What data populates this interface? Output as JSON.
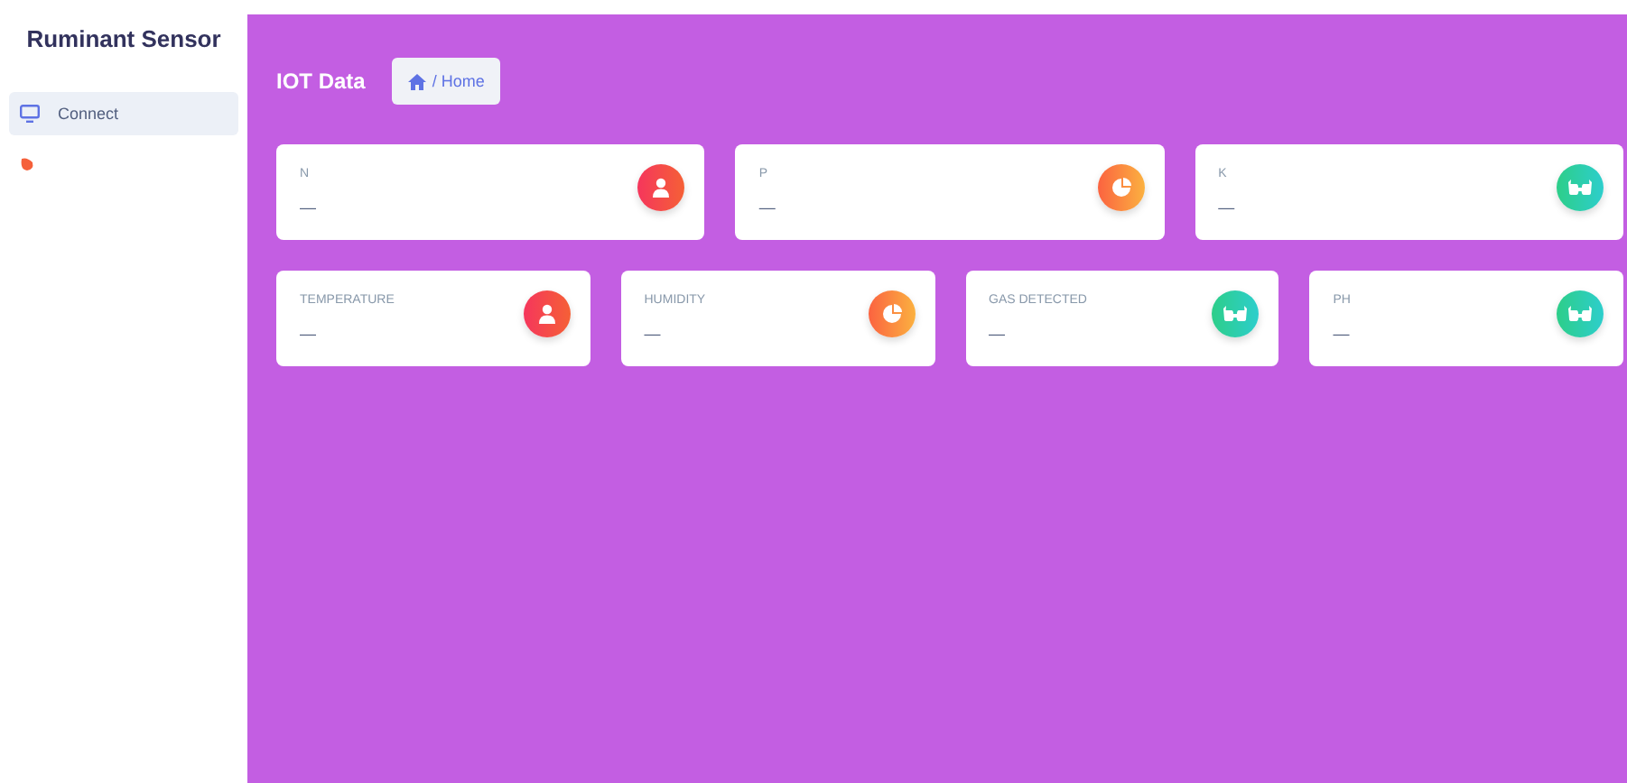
{
  "sidebar": {
    "title": "Ruminant Sensor",
    "items": [
      {
        "kind": "monitor",
        "label": "Connect",
        "selected": true
      },
      {
        "kind": "blob",
        "selected": false
      }
    ]
  },
  "header": {
    "title": "IOT Data",
    "breadcrumb": "/ Home"
  },
  "card_rows": [
    [
      {
        "label": "N",
        "value": "—",
        "kind": "person"
      },
      {
        "label": "P",
        "value": "—",
        "kind": "pie"
      },
      {
        "label": "K",
        "value": "—",
        "kind": "glasses"
      }
    ],
    [
      {
        "label": "TEMPERATURE",
        "value": "—",
        "kind": "person"
      },
      {
        "label": "HUMIDITY",
        "value": "—",
        "kind": "pie"
      },
      {
        "label": "GAS DETECTED",
        "value": "—",
        "kind": "glasses"
      },
      {
        "label": "PH",
        "value": "—",
        "kind": "glasses"
      }
    ]
  ]
}
